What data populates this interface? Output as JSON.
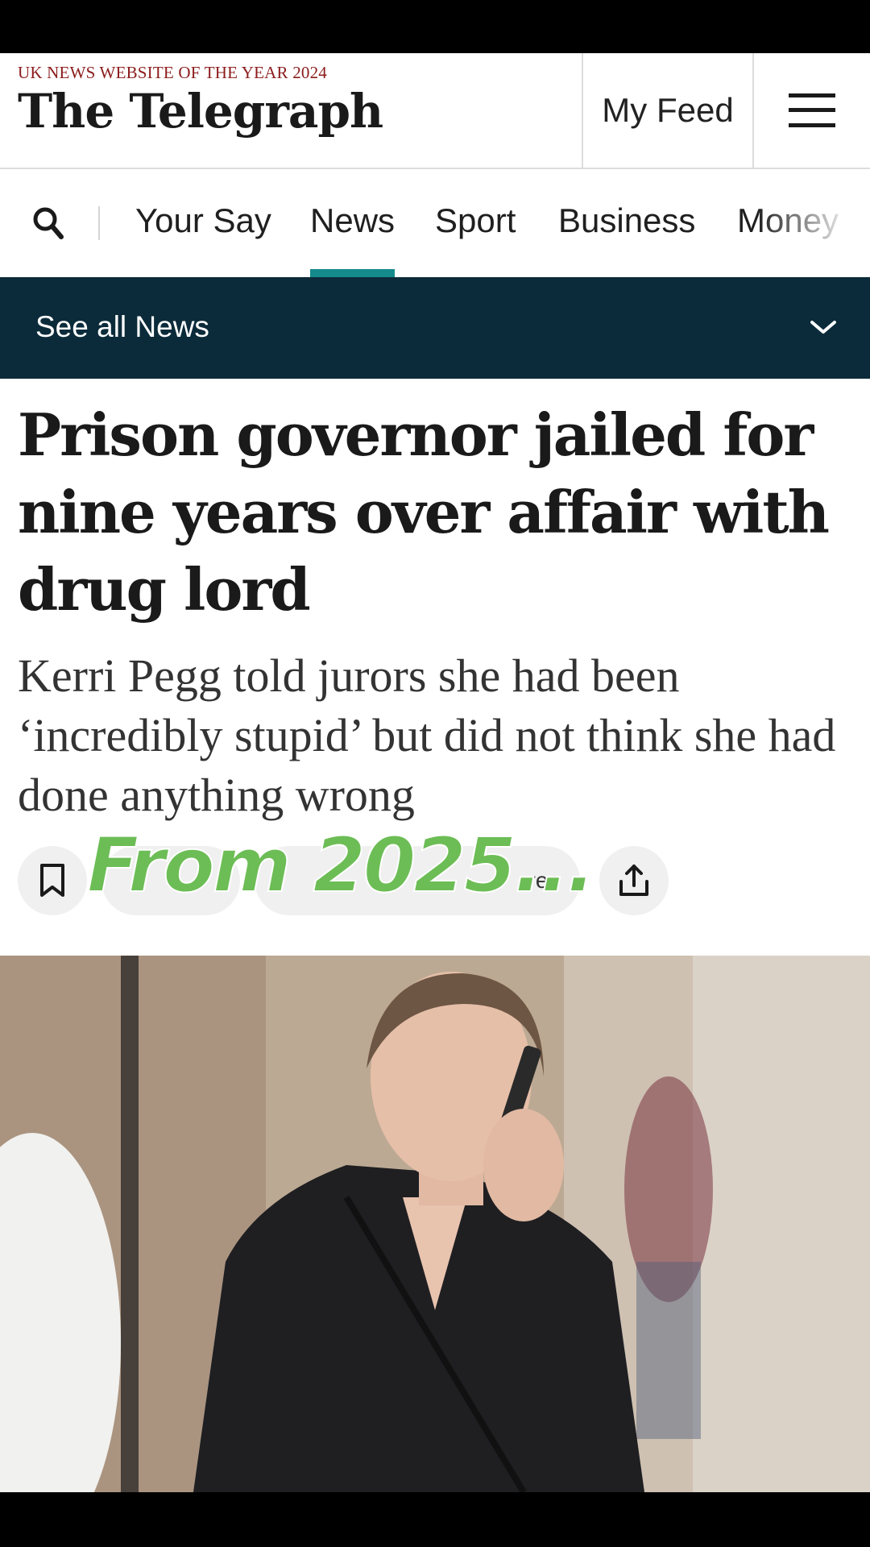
{
  "masthead": {
    "award": "UK NEWS WEBSITE OF THE YEAR 2024",
    "logo": "The Telegraph",
    "my_feed": "My Feed",
    "menu_icon": "hamburger-menu-icon"
  },
  "nav": {
    "search_icon": "search-icon",
    "items": [
      {
        "label": "Your Say",
        "active": false
      },
      {
        "label": "News",
        "active": true
      },
      {
        "label": "Sport",
        "active": false
      },
      {
        "label": "Business",
        "active": false
      },
      {
        "label": "Money",
        "active": false
      }
    ],
    "active_color": "#148a8c"
  },
  "subnav": {
    "label": "See all News",
    "chevron_icon": "chevron-down-icon",
    "background": "#0b2b3a"
  },
  "article": {
    "headline": "Prison governor jailed for nine years over affair with drug lord",
    "standfirst": "Kerri Pegg told jurors she had been ‘incredibly stupid’ but did not think she had done anything wrong",
    "actions": {
      "bookmark_icon": "bookmark-icon",
      "gift_partial": "ree",
      "share_icon": "share-icon"
    },
    "overlay_caption": "From 2025..."
  },
  "hero_image": {
    "alt": "Woman in a black coat talking on a phone on a city street"
  }
}
